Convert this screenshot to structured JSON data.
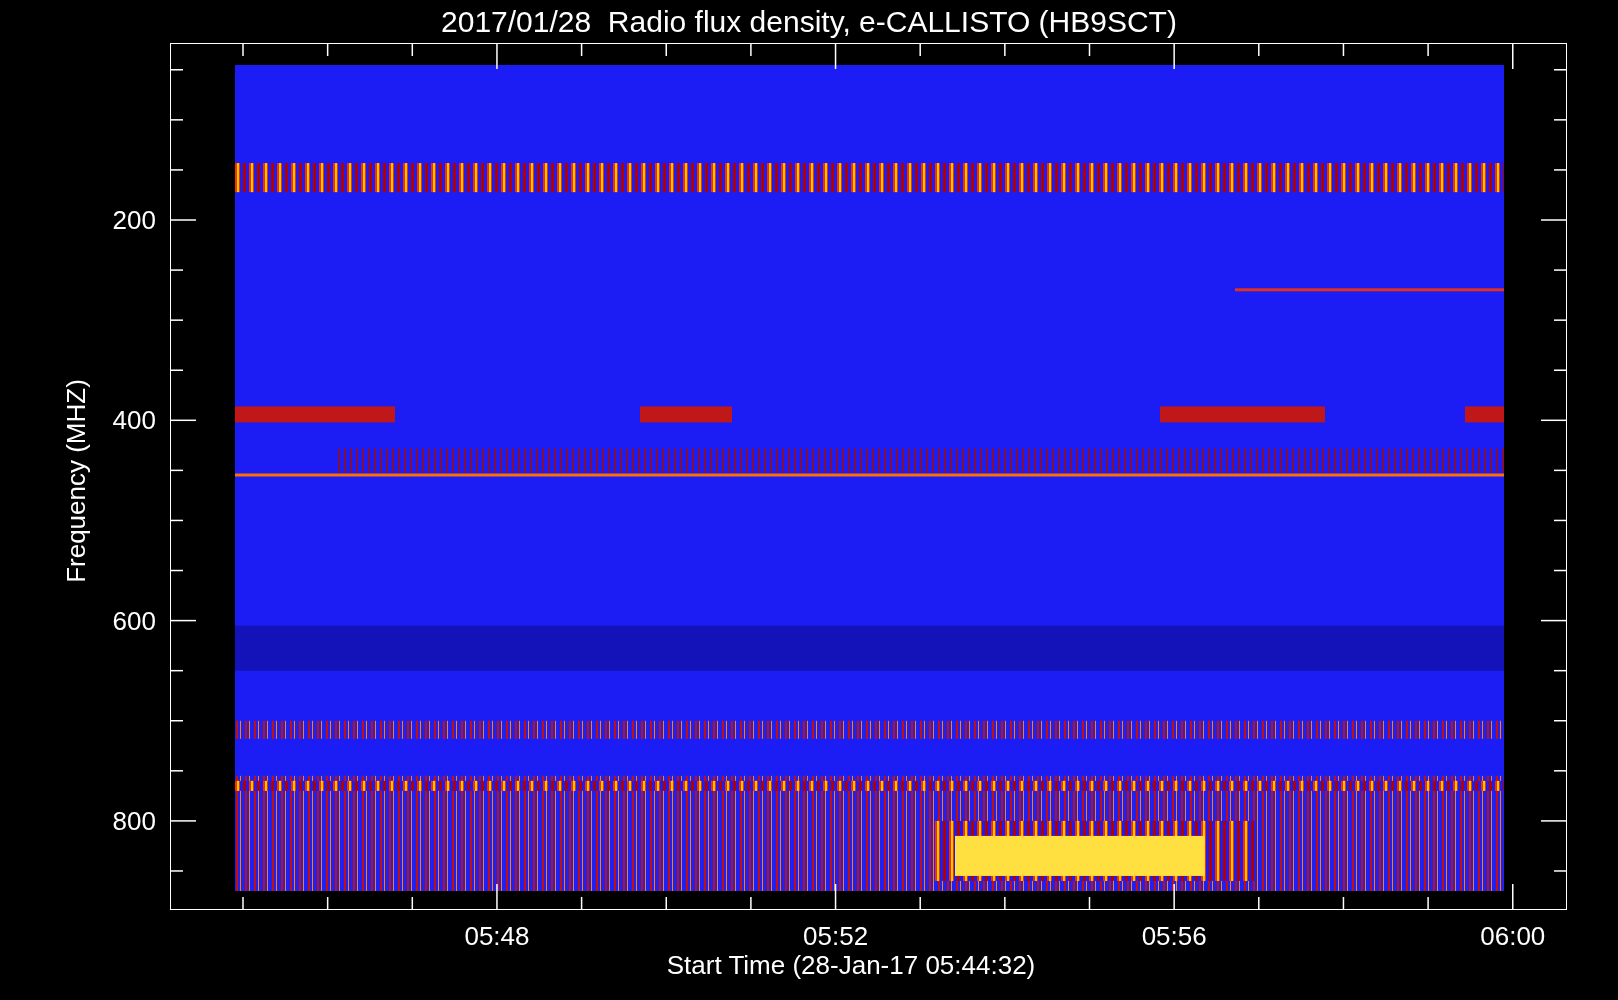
{
  "title": "2017/01/28  Radio flux density, e-CALLISTO (HB9SCT)",
  "y_axis": {
    "label": "Frequency (MHZ)",
    "ticks": [
      "200",
      "400",
      "600",
      "800"
    ]
  },
  "x_axis": {
    "label": "Start Time (28-Jan-17 05:44:32)",
    "ticks": [
      "05:48",
      "05:52",
      "05:56",
      "06:00"
    ]
  }
}
